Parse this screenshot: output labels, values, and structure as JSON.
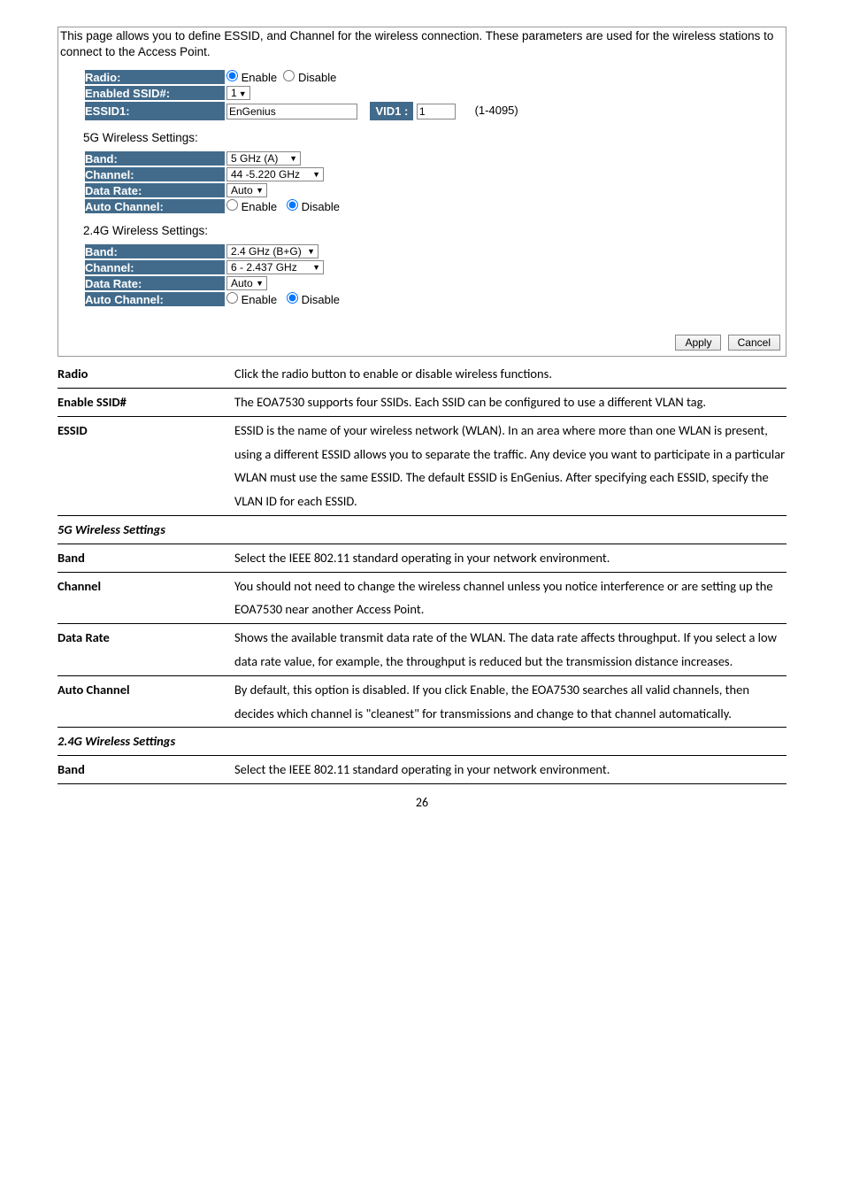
{
  "panel": {
    "description": "This page allows you to define ESSID, and Channel for the wireless connection. These parameters are used for the wireless stations to connect to the Access Point.",
    "radio": {
      "label": "Radio:",
      "enable": "Enable",
      "disable": "Disable"
    },
    "enabled_ssid": {
      "label": "Enabled SSID#:",
      "value": "1"
    },
    "essid1": {
      "label": "ESSID1:",
      "value": "EnGenius",
      "vid_label": "VID1 :",
      "vid_value": "1",
      "vid_range": "(1-4095)"
    },
    "g5_heading": "5G Wireless Settings:",
    "g5": {
      "band_label": "Band:",
      "band_value": "5 GHz (A)",
      "channel_label": "Channel:",
      "channel_value": "44 -5.220 GHz",
      "rate_label": "Data Rate:",
      "rate_value": "Auto",
      "auto_label": "Auto Channel:",
      "enable": "Enable",
      "disable": "Disable"
    },
    "g24_heading": "2.4G Wireless Settings:",
    "g24": {
      "band_label": "Band:",
      "band_value": "2.4 GHz (B+G)",
      "channel_label": "Channel:",
      "channel_value": "6 - 2.437 GHz",
      "rate_label": "Data Rate:",
      "rate_value": "Auto",
      "auto_label": "Auto Channel:",
      "enable": "Enable",
      "disable": "Disable"
    },
    "apply": "Apply",
    "cancel": "Cancel"
  },
  "rows": [
    {
      "label": "Radio",
      "text": "Click the radio button to enable or disable wireless functions."
    },
    {
      "label": "Enable SSID#",
      "text": "The EOA7530 supports four SSIDs. Each SSID can be configured to use a different VLAN tag."
    },
    {
      "label": "ESSID",
      "text": "ESSID is the name of your wireless network (WLAN). In an area where more than one WLAN is present, using a different ESSID allows you to separate the traffic. Any device you want to participate in a particular WLAN must use the same ESSID. The default ESSID is EnGenius. After specifying each ESSID, specify the VLAN ID for each ESSID."
    },
    {
      "label": "5G Wireless Settings",
      "italic": true,
      "text": ""
    },
    {
      "label": "Band",
      "text": "Select the IEEE 802.11 standard operating in your network environment."
    },
    {
      "label": "Channel",
      "text": "You should not need to change the wireless channel unless you notice interference or are setting up the EOA7530 near another Access Point."
    },
    {
      "label": "Data Rate",
      "text": "Shows the available transmit data rate of the WLAN. The data rate affects throughput. If you select a low data rate value, for example, the throughput is reduced but the transmission distance increases."
    },
    {
      "label": "Auto Channel",
      "text": "By default, this option is disabled. If you click Enable, the EOA7530 searches all valid channels, then decides which channel is \"cleanest\" for transmissions and change to that channel automatically."
    },
    {
      "label": "2.4G Wireless Settings",
      "italic": true,
      "text": ""
    },
    {
      "label": "Band",
      "text": "Select the IEEE 802.11 standard operating in your network environment."
    }
  ],
  "page_num": "26"
}
